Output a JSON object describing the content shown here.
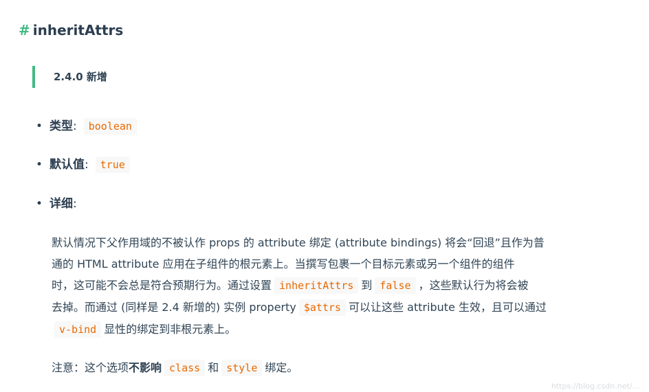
{
  "heading": {
    "anchor": "#",
    "title": "inheritAttrs"
  },
  "version_note": "2.4.0 新增",
  "props": [
    {
      "label": "类型",
      "colon": ":",
      "code": "boolean"
    },
    {
      "label": "默认值",
      "colon": ":",
      "code": "true"
    },
    {
      "label": "详细",
      "colon": ":"
    }
  ],
  "detail": {
    "p1": "默认情况下父作用域的不被认作 props 的 attribute 绑定 (attribute bindings) 将会“回退”且作为普",
    "p2": "通的 HTML attribute 应用在子组件的根元素上。当撰写包裹一个目标元素或另一个组件的组件",
    "p3a": "时，这可能不会总是符合预期行为。通过设置",
    "c1": "inheritAttrs",
    "p3b": "到",
    "c2": "false",
    "p3c": "，这些默认行为将会被",
    "p4a": "去掉。而通过 (同样是 2.4 新增的) 实例 property",
    "c3": "$attrs",
    "p4b": "可以让这些 attribute 生效，且可以通过",
    "c4": "v-bind",
    "p5": "显性的绑定到非根元素上。"
  },
  "note": {
    "prefix": "注意：这个选项",
    "strong": "不影响",
    "code1": "class",
    "mid": "和",
    "code2": "style",
    "suffix": "绑定。"
  },
  "watermark": "https://blog.csdn.net/..."
}
